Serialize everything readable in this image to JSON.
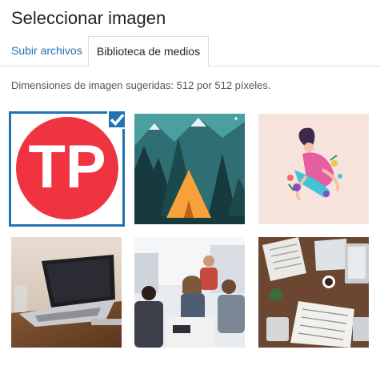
{
  "modal": {
    "title": "Seleccionar imagen",
    "tabs": [
      {
        "label": "Subir archivos",
        "active": false
      },
      {
        "label": "Biblioteca de medios",
        "active": true
      }
    ],
    "hint": "Dimensiones de imagen sugeridas: 512 por 512 píxeles."
  },
  "library": {
    "items": [
      {
        "name": "tp-logo",
        "selected": true,
        "logo_text": "TP"
      },
      {
        "name": "camping-tent-illustration",
        "selected": false
      },
      {
        "name": "woman-flowers-illustration",
        "selected": false
      },
      {
        "name": "laptop-on-desk-photo",
        "selected": false
      },
      {
        "name": "office-meeting-photo",
        "selected": false
      },
      {
        "name": "newspapers-desk-photo",
        "selected": false
      }
    ]
  },
  "colors": {
    "accent": "#2271b1",
    "logo_red": "#ef3340",
    "tent_orange": "#f7a13a",
    "tent_sky": "#4c9fa0",
    "illustration_bg": "#f6e4dc"
  }
}
